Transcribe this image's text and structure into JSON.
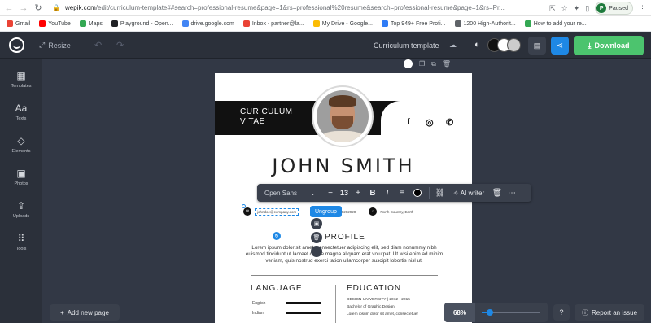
{
  "browser": {
    "url_host": "wepik.com",
    "url_path": "/edit/curriculum-template##search=professional-resume&page=1&rs=professional%20resume&search=professional-resume&page=1&rs=Pr...",
    "profile_status": "Paused",
    "profile_initial": "P"
  },
  "bookmarks": [
    {
      "label": "Gmail",
      "color": "#ea4335"
    },
    {
      "label": "YouTube",
      "color": "#ff0000"
    },
    {
      "label": "Maps",
      "color": "#34a853"
    },
    {
      "label": "Playground - Open...",
      "color": "#202124"
    },
    {
      "label": "drive.google.com",
      "color": "#4285f4"
    },
    {
      "label": "Inbox - partner@la...",
      "color": "#ea4335"
    },
    {
      "label": "My Drive - Google...",
      "color": "#fbbc04"
    },
    {
      "label": "Top 949+ Free Profi...",
      "color": "#2f7cf6"
    },
    {
      "label": "1200 High-Authorit...",
      "color": "#5f6368"
    },
    {
      "label": "How to add your re...",
      "color": "#34a853"
    }
  ],
  "topbar": {
    "resize_label": "Resize",
    "doc_title": "Curriculum template",
    "download_label": "Download",
    "swatch_colors": [
      "#111111",
      "#ffffff",
      "#cccccc"
    ]
  },
  "sidebar": {
    "items": [
      {
        "label": "Templates",
        "icon": "templates-icon",
        "glyph": "▦"
      },
      {
        "label": "Texts",
        "icon": "text-icon",
        "glyph": "Aa"
      },
      {
        "label": "Elements",
        "icon": "shapes-icon",
        "glyph": "◇"
      },
      {
        "label": "Photos",
        "icon": "image-icon",
        "glyph": "▣"
      },
      {
        "label": "Uploads",
        "icon": "upload-icon",
        "glyph": "⇪"
      },
      {
        "label": "Tools",
        "icon": "grid-icon",
        "glyph": "⠿"
      }
    ]
  },
  "resume": {
    "cv_title_line1": "CURICULUM",
    "cv_title_line2": "VITAE",
    "name": "JOHN SMITH",
    "email": "johndoe@company.com",
    "phone": "889920202920",
    "location": "North Country, Earth",
    "profile_heading": "PROFILE",
    "profile_text": "Lorem ipsum dolor sit amet, consectetuer adipiscing elit, sed diam nonummy nibh euismod tincidunt ut laoreet dolore magna aliquam erat volutpat. Ut wisi enim ad minim veniam, quis nostrud exerci tation ullamcorper suscipit lobortis nisl ut.",
    "language_heading": "LANGUAGE",
    "languages": [
      "English",
      "Indian"
    ],
    "education_heading": "EDUCATION",
    "edu_school": "DESIGN UNIVERSITY",
    "edu_years": "2012 - 2015",
    "edu_degree": "Bachelor of Graphic Design",
    "edu_text": "Lorem ipsum dolor sit amet, consectetuer"
  },
  "text_toolbar": {
    "font": "Open Sans",
    "size": "13",
    "ai_label": "AI writer",
    "text_color": "#000000"
  },
  "selection": {
    "ungroup_label": "Ungroup"
  },
  "bottom": {
    "add_page_label": "Add new page",
    "zoom_label": "68%",
    "zoom_value": 0.68,
    "report_label": "Report an issue"
  }
}
